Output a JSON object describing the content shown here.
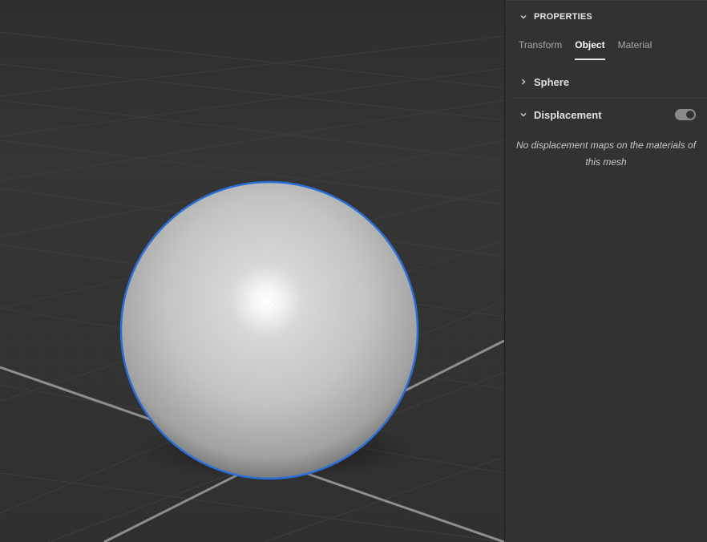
{
  "viewport": {
    "selection_color": "#2a6fd8",
    "background_color": "#333333"
  },
  "panel": {
    "title": "PROPERTIES",
    "tabs": [
      {
        "label": "Transform",
        "active": false
      },
      {
        "label": "Object",
        "active": true
      },
      {
        "label": "Material",
        "active": false
      }
    ],
    "sections": {
      "sphere": {
        "label": "Sphere",
        "expanded": false
      },
      "displacement": {
        "label": "Displacement",
        "expanded": true,
        "toggle_on": true,
        "message": "No displacement maps on the materials of this mesh"
      }
    }
  }
}
